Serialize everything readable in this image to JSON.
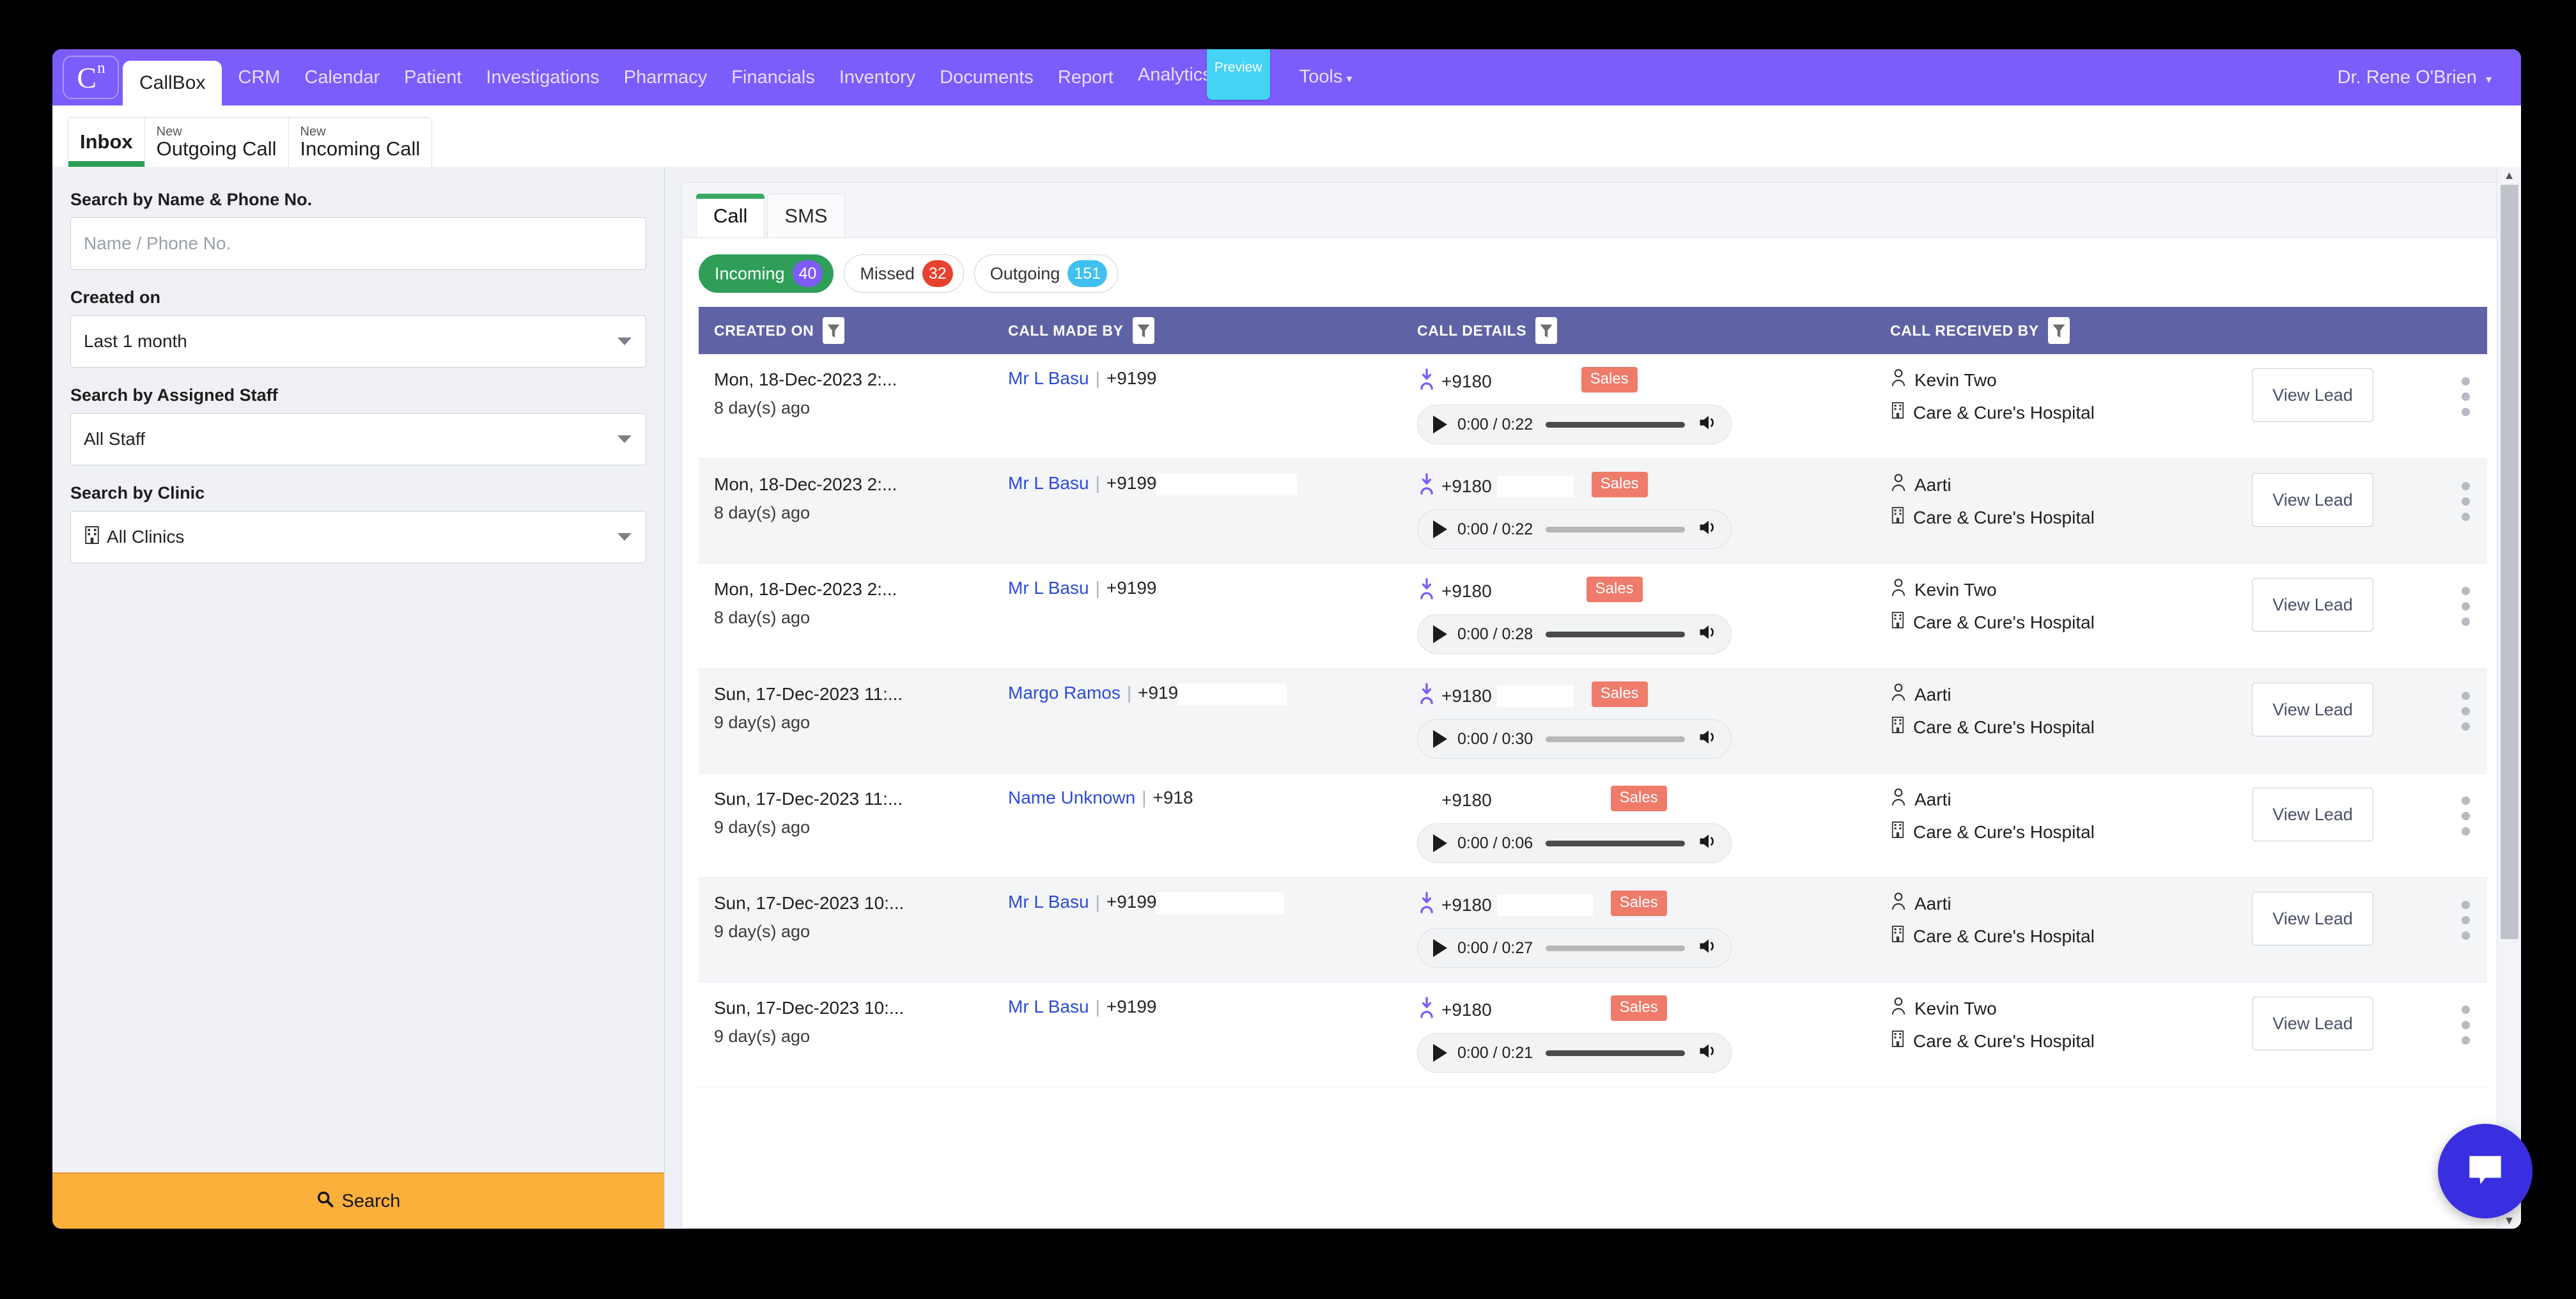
{
  "navbar": {
    "logo_letter": "C",
    "logo_sup": "n",
    "active_tab": "CallBox",
    "links": [
      {
        "label": "CRM"
      },
      {
        "label": "Calendar"
      },
      {
        "label": "Patient"
      },
      {
        "label": "Investigations"
      },
      {
        "label": "Pharmacy"
      },
      {
        "label": "Financials"
      },
      {
        "label": "Inventory"
      },
      {
        "label": "Documents"
      },
      {
        "label": "Report"
      },
      {
        "label": "Analytics"
      }
    ],
    "preview_badge": "Preview",
    "tools_label": "Tools",
    "tools_caret": "▾",
    "user_label": "Dr. Rene O'Brien",
    "user_caret": "▾",
    "bg_color": "#7c5cfa",
    "badge_color": "#44d2f5"
  },
  "subtabs": [
    {
      "small": "",
      "big": "Inbox",
      "active": true
    },
    {
      "small": "New",
      "big": "Outgoing Call",
      "active": false
    },
    {
      "small": "New",
      "big": "Incoming Call",
      "active": false
    }
  ],
  "sidebar": {
    "name_phone_label": "Search by Name & Phone No.",
    "name_phone_placeholder": "Name / Phone No.",
    "name_phone_value": "",
    "created_on_label": "Created on",
    "created_on_value": "Last 1 month",
    "assigned_staff_label": "Search by Assigned Staff",
    "assigned_staff_value": "All Staff",
    "clinic_label": "Search by Clinic",
    "clinic_value": "All Clinics",
    "search_button": "Search",
    "search_button_color": "#fbb03b"
  },
  "panel": {
    "channel_tabs": [
      {
        "label": "Call",
        "active": true
      },
      {
        "label": "SMS",
        "active": false
      }
    ],
    "pills": [
      {
        "label": "Incoming",
        "count": "40",
        "active": true,
        "count_color": "#7f5cf5"
      },
      {
        "label": "Missed",
        "count": "32",
        "active": false,
        "count_color": "#e8412f"
      },
      {
        "label": "Outgoing",
        "count": "151",
        "active": false,
        "count_color": "#3fc0f0"
      }
    ],
    "columns": [
      {
        "label": "CREATED ON"
      },
      {
        "label": "CALL MADE BY"
      },
      {
        "label": "CALL DETAILS"
      },
      {
        "label": "CALL RECEIVED BY"
      }
    ],
    "header_bg": "#5f63a6",
    "action_label": "View Lead",
    "badge_label": "Sales",
    "badge_color": "#ef7b6b",
    "rows": [
      {
        "date": "Mon, 18-Dec-2023 2:...",
        "ago": "8 day(s) ago",
        "caller_name": "Mr L Basu",
        "caller_phone": "+9199",
        "caller_redact_w": 180,
        "detail_phone": "+9180",
        "detail_redact_w": 104,
        "has_in_icon": true,
        "badge": "Sales",
        "audio_time": "0:00 / 0:22",
        "received_person": "Kevin Two",
        "received_clinic": "Care & Cure's Hospital",
        "action": "View Lead"
      },
      {
        "date": "Mon, 18-Dec-2023 2:...",
        "ago": "8 day(s) ago",
        "caller_name": "Mr L Basu",
        "caller_phone": "+9199",
        "caller_redact_w": 220,
        "detail_phone": "+9180",
        "detail_redact_w": 120,
        "has_in_icon": true,
        "badge": "Sales",
        "audio_time": "0:00 / 0:22",
        "received_person": "Aarti",
        "received_clinic": "Care & Cure's Hospital",
        "action": "View Lead"
      },
      {
        "date": "Mon, 18-Dec-2023 2:...",
        "ago": "8 day(s) ago",
        "caller_name": "Mr L Basu",
        "caller_phone": "+9199",
        "caller_redact_w": 180,
        "detail_phone": "+9180",
        "detail_redact_w": 112,
        "has_in_icon": true,
        "badge": "Sales",
        "audio_time": "0:00 / 0:28",
        "received_person": "Kevin Two",
        "received_clinic": "Care & Cure's Hospital",
        "action": "View Lead"
      },
      {
        "date": "Sun, 17-Dec-2023 11:...",
        "ago": "9 day(s) ago",
        "caller_name": "Margo Ramos",
        "caller_phone": "+919",
        "caller_redact_w": 170,
        "detail_phone": "+9180",
        "detail_redact_w": 120,
        "has_in_icon": true,
        "badge": "Sales",
        "audio_time": "0:00 / 0:30",
        "received_person": "Aarti",
        "received_clinic": "Care & Cure's Hospital",
        "action": "View Lead"
      },
      {
        "date": "Sun, 17-Dec-2023 11:...",
        "ago": "9 day(s) ago",
        "caller_name": "Name Unknown",
        "caller_phone": "+918",
        "caller_redact_w": 150,
        "detail_phone": "+9180",
        "detail_redact_w": 150,
        "has_in_icon": false,
        "badge": "Sales",
        "audio_time": "0:00 / 0:06",
        "received_person": "Aarti",
        "received_clinic": "Care & Cure's Hospital",
        "action": "View Lead"
      },
      {
        "date": "Sun, 17-Dec-2023 10:...",
        "ago": "9 day(s) ago",
        "caller_name": "Mr L Basu",
        "caller_phone": "+9199",
        "caller_redact_w": 200,
        "detail_phone": "+9180",
        "detail_redact_w": 150,
        "has_in_icon": true,
        "badge": "Sales",
        "audio_time": "0:00 / 0:27",
        "received_person": "Aarti",
        "received_clinic": "Care & Cure's Hospital",
        "action": "View Lead"
      },
      {
        "date": "Sun, 17-Dec-2023 10:...",
        "ago": "9 day(s) ago",
        "caller_name": "Mr L Basu",
        "caller_phone": "+9199",
        "caller_redact_w": 200,
        "detail_phone": "+9180",
        "detail_redact_w": 150,
        "has_in_icon": true,
        "badge": "Sales",
        "audio_time": "0:00 / 0:21",
        "received_person": "Kevin Two",
        "received_clinic": "Care & Cure's Hospital",
        "action": "View Lead"
      }
    ]
  },
  "scrollbar": {
    "up": "▲",
    "down": "▼"
  },
  "chat_widget": {
    "name": "chat-bubble"
  }
}
